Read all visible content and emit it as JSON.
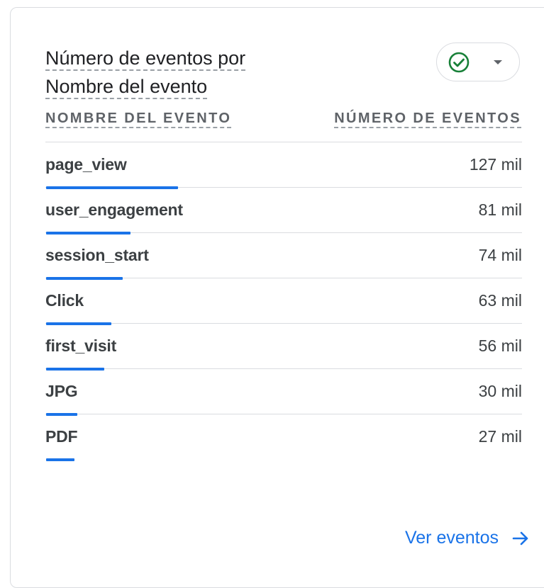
{
  "card": {
    "title_line1": "Número de eventos por",
    "title_line2": "Nombre del evento",
    "status_icon": "check-circle-icon",
    "dropdown_icon": "caret-down-icon"
  },
  "table": {
    "columns": [
      "NOMBRE DEL EVENTO",
      "NÚMERO DE EVENTOS"
    ],
    "rows": [
      {
        "name": "page_view",
        "value": "127 mil",
        "count": 127
      },
      {
        "name": "user_engagement",
        "value": "81 mil",
        "count": 81
      },
      {
        "name": "session_start",
        "value": "74 mil",
        "count": 74
      },
      {
        "name": "Click",
        "value": "63 mil",
        "count": 63
      },
      {
        "name": "first_visit",
        "value": "56 mil",
        "count": 56
      },
      {
        "name": "JPG",
        "value": "30 mil",
        "count": 30
      },
      {
        "name": "PDF",
        "value": "27 mil",
        "count": 27
      }
    ]
  },
  "footer": {
    "link_label": "Ver eventos",
    "link_icon": "arrow-right-icon"
  },
  "colors": {
    "accent": "#1a73e8",
    "success": "#188038",
    "text": "#3c4043",
    "muted": "#5f6368",
    "divider": "#dadce0"
  }
}
